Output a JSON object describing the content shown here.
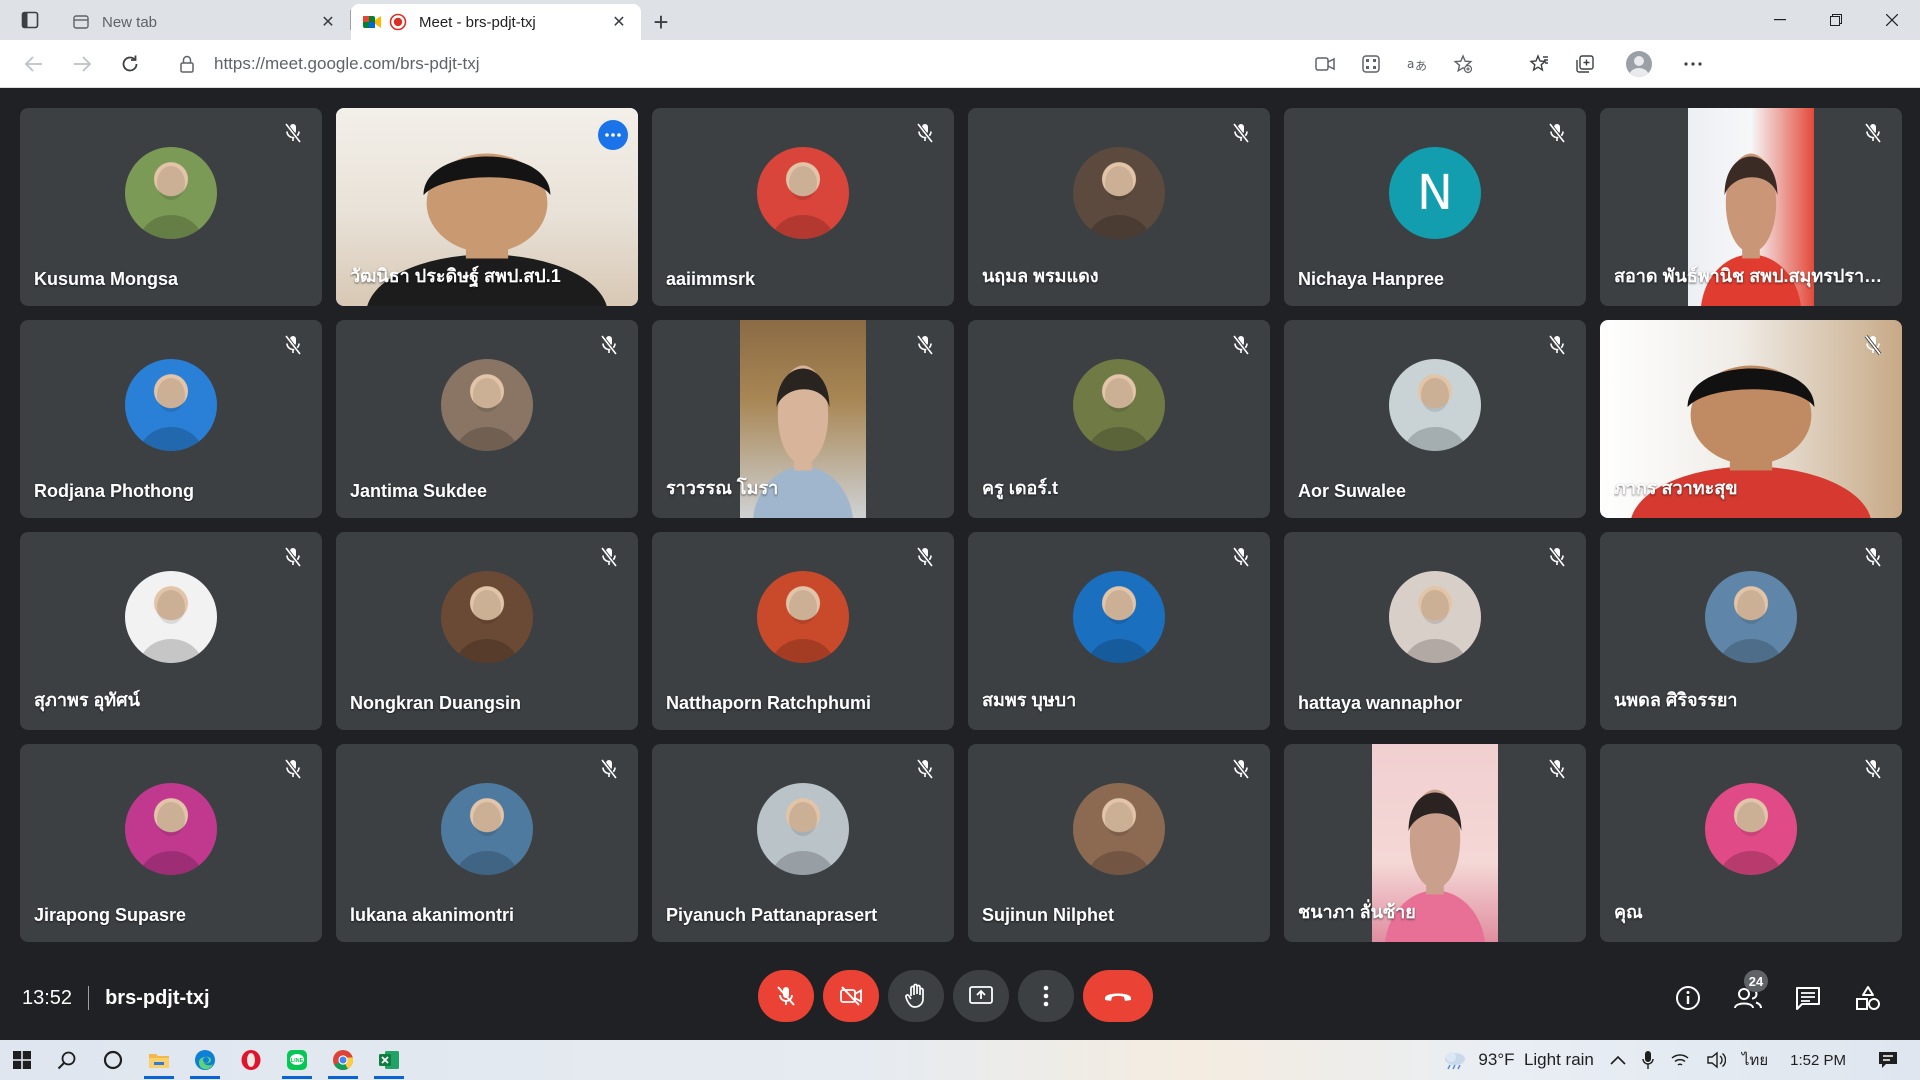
{
  "browser": {
    "tabs": [
      {
        "title": "New tab",
        "active": false
      },
      {
        "title": "Meet - brs-pdjt-txj",
        "active": true
      }
    ],
    "new_tab_symbol": "+",
    "url": "https://meet.google.com/brs-pdjt-txj"
  },
  "participants": [
    {
      "name": "Kusuma Mongsa",
      "avatar": "photo",
      "color": "#7a9a56"
    },
    {
      "name": "วัฒนิธา ประดิษฐ์ สพป.สป.1",
      "avatar": "video",
      "speaking": true
    },
    {
      "name": "aaiimmsrk",
      "avatar": "photo",
      "color": "#d9453b"
    },
    {
      "name": "นฤมล พรมแดง",
      "avatar": "photo",
      "color": "#5b4a3d"
    },
    {
      "name": "Nichaya Hanpree",
      "avatar": "letter",
      "letter": "N",
      "color": "#129eaf"
    },
    {
      "name": "สอาด พันธ์พานิช สพป.สมุทรปราก...",
      "avatar": "video"
    },
    {
      "name": "Rodjana Phothong",
      "avatar": "photo",
      "color": "#2a7fd6"
    },
    {
      "name": "Jantima Sukdee",
      "avatar": "photo",
      "color": "#8a7564"
    },
    {
      "name": "ราวรรณ โมรา",
      "avatar": "video"
    },
    {
      "name": "ครู เดอร์.t",
      "avatar": "photo",
      "color": "#6f7a45"
    },
    {
      "name": "Aor Suwalee",
      "avatar": "photo",
      "color": "#c9d3d6"
    },
    {
      "name": "ภากร สวาทะสุข",
      "avatar": "video"
    },
    {
      "name": "สุภาพร อุทัศน์",
      "avatar": "photo",
      "color": "#f2f2f2"
    },
    {
      "name": "Nongkran Duangsin",
      "avatar": "photo",
      "color": "#6b4a35"
    },
    {
      "name": "Natthaporn Ratchphumi",
      "avatar": "photo",
      "color": "#c94a2b"
    },
    {
      "name": "สมพร บุษบา",
      "avatar": "photo",
      "color": "#1b6fbf"
    },
    {
      "name": "hattaya wannaphor",
      "avatar": "photo",
      "color": "#d9cfc9"
    },
    {
      "name": "นพดล ศิริจรรยา",
      "avatar": "photo",
      "color": "#5f86a8"
    },
    {
      "name": "Jirapong Supasre",
      "avatar": "photo",
      "color": "#c0398f"
    },
    {
      "name": "lukana akanimontri",
      "avatar": "photo",
      "color": "#4f7aa0"
    },
    {
      "name": "Piyanuch Pattanaprasert",
      "avatar": "photo",
      "color": "#b9c3c8"
    },
    {
      "name": "Sujinun Nilphet",
      "avatar": "photo",
      "color": "#8c6a52"
    },
    {
      "name": "ชนาภา ลั่นซ้าย",
      "avatar": "video"
    },
    {
      "name": "คุณ",
      "avatar": "photo",
      "color": "#e04a86"
    }
  ],
  "meeting": {
    "time": "13:52",
    "code": "brs-pdjt-txj",
    "participant_count": "24"
  },
  "controls": {
    "mic_icon": "mic-off-icon",
    "camera_icon": "camera-off-icon",
    "raise_hand_icon": "raise-hand-icon",
    "present_icon": "present-screen-icon",
    "more_icon": "more-options-icon",
    "leave_icon": "leave-call-icon"
  },
  "taskbar": {
    "weather": "93°F  Light rain",
    "language": "ไทย",
    "clock": "1:52 PM"
  },
  "colors": {
    "meet_bg": "#202124",
    "tile_bg": "#3c4043",
    "danger": "#ea4335",
    "accent": "#1a73e8"
  }
}
